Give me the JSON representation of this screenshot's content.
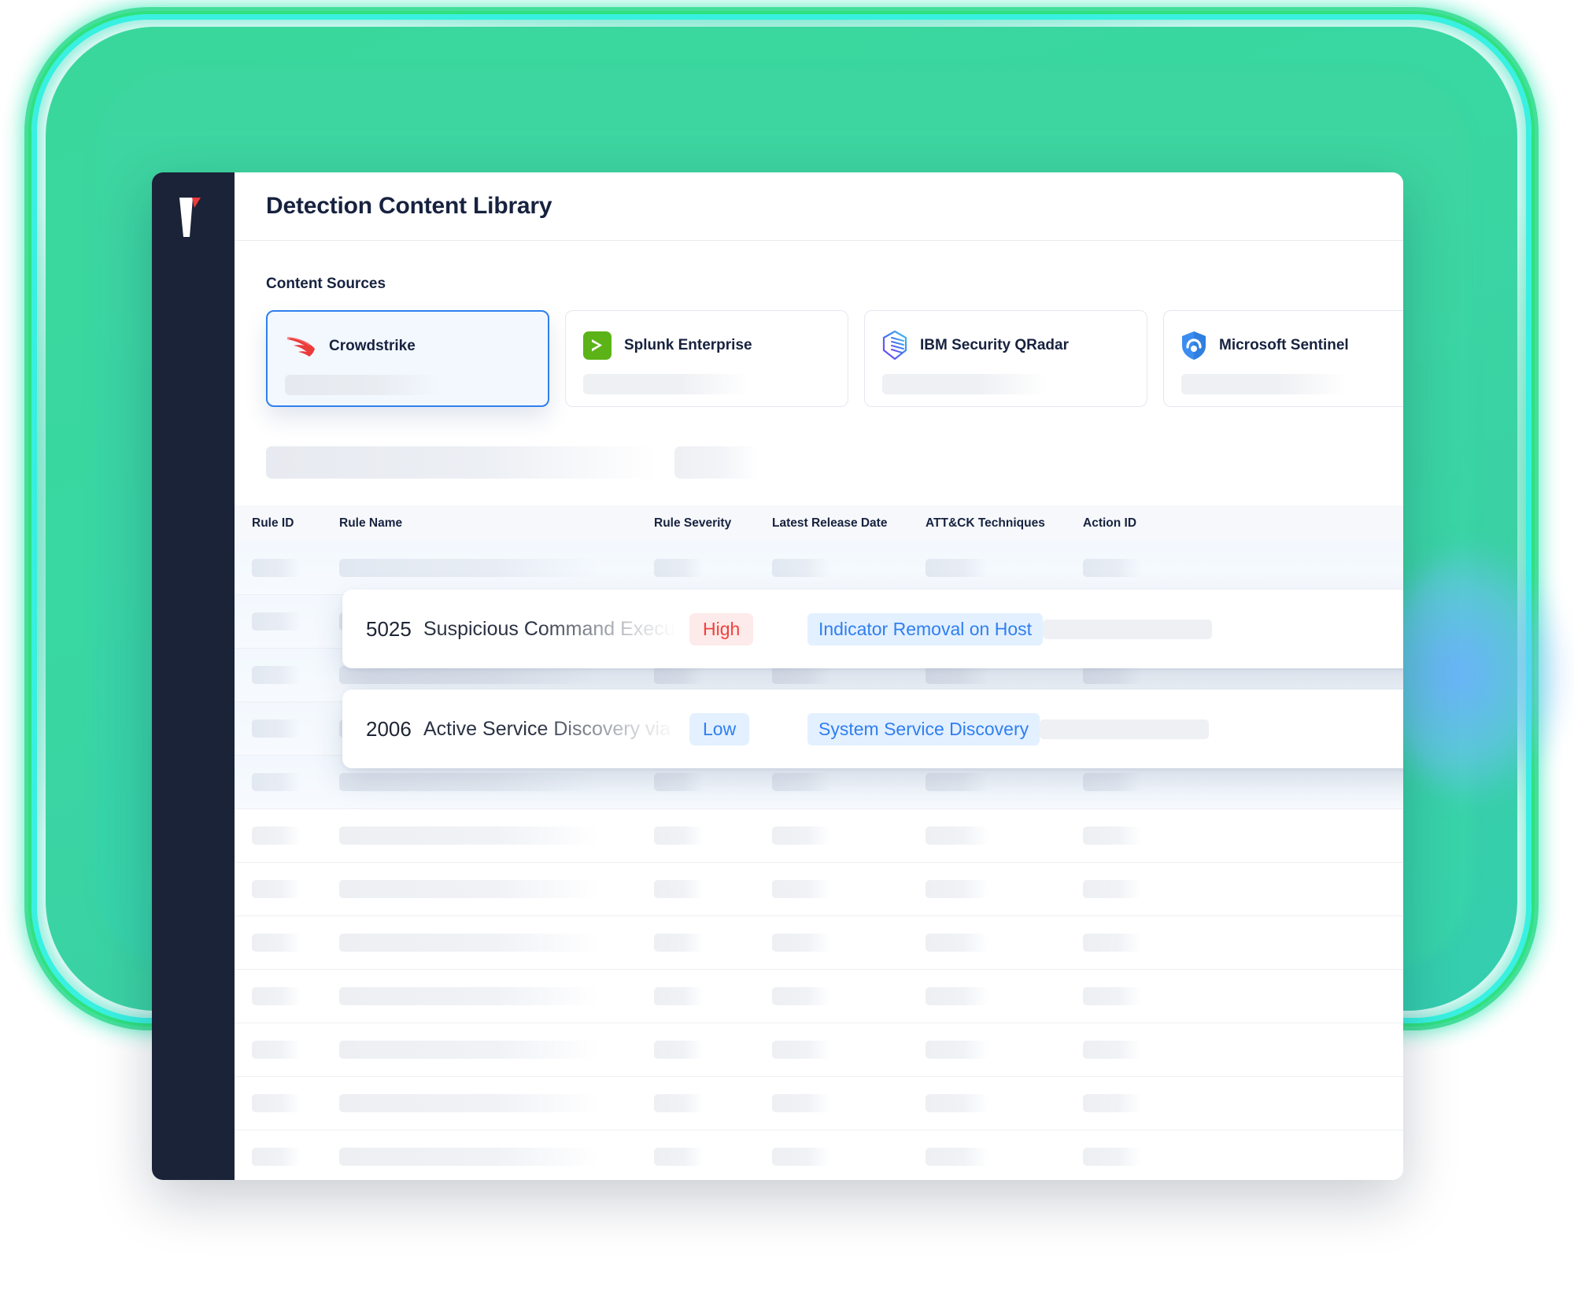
{
  "app": {
    "logo_name": "vendor-logo",
    "title": "Detection Content Library"
  },
  "sources_section": {
    "label": "Content Sources",
    "cards": [
      {
        "name": "Crowdstrike",
        "icon": "crowdstrike-falcon-icon",
        "selected": true
      },
      {
        "name": "Splunk Enterprise",
        "icon": "splunk-chevron-icon",
        "selected": false
      },
      {
        "name": "IBM Security QRadar",
        "icon": "qradar-shield-icon",
        "selected": false
      },
      {
        "name": "Microsoft Sentinel",
        "icon": "sentinel-shield-icon",
        "selected": false
      }
    ]
  },
  "table": {
    "columns": [
      "Rule ID",
      "Rule Name",
      "Rule Severity",
      "Latest Release Date",
      "ATT&CK Techniques",
      "Action ID"
    ],
    "highlighted_rows": [
      {
        "rule_id": "5025",
        "rule_name": "Suspicious Command Executi...",
        "severity": "High",
        "severity_color": "#f0423c",
        "attack_technique": "Indicator Removal on Host"
      },
      {
        "rule_id": "2006",
        "rule_name": "Active Service Discovery via s",
        "severity": "Low",
        "severity_color": "#2f7ff0",
        "attack_technique": "System Service Discovery"
      }
    ],
    "placeholder_row_count": 12
  },
  "theme": {
    "accent_blue": "#2f7ff0",
    "sidebar_dark": "#1b2338",
    "glow_green": "#3ad79c",
    "glow_cyan": "#2ff0e0",
    "text_navy": "#17223f"
  }
}
